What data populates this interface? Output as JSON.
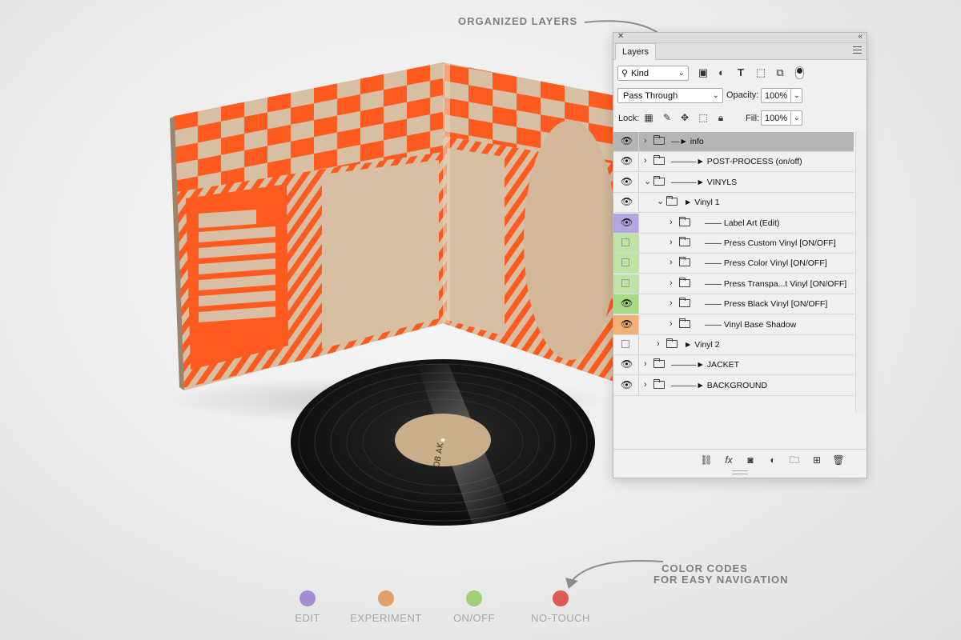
{
  "annotations": {
    "organized_layers": "ORGANIZED LAYERS",
    "color_codes_line1": "COLOR CODES",
    "color_codes_line2": "FOR EASY NAVIGATION"
  },
  "legend": [
    {
      "label": "EDIT",
      "color": "#a78bd6"
    },
    {
      "label": "EXPERIMENT",
      "color": "#e0a06a"
    },
    {
      "label": "ON/OFF",
      "color": "#9fd172"
    },
    {
      "label": "NO-TOUCH",
      "color": "#e05a54"
    }
  ],
  "vinyl_label_text": "OB AK",
  "panel": {
    "tab_label": "Layers",
    "filter": {
      "value": "Kind"
    },
    "blend_mode": "Pass Through",
    "opacity_label": "Opacity:",
    "opacity_value": "100%",
    "lock_label": "Lock:",
    "fill_label": "Fill:",
    "fill_value": "100%",
    "layers": [
      {
        "name": "—► info",
        "visible": true,
        "selected": true
      },
      {
        "name": "———► POST-PROCESS (on/off)",
        "visible": true
      },
      {
        "name": "———► VINYLS",
        "visible": true,
        "expanded": true
      },
      {
        "name": "► Vinyl 1",
        "visible": true,
        "expanded": true
      },
      {
        "name": "—— Label Art (Edit)",
        "visible": true,
        "color": "#b4a6e0"
      },
      {
        "name": "—— Press Custom Vinyl [ON/OFF]",
        "visible": false,
        "color": "#bfe3a4"
      },
      {
        "name": "—— Press Color Vinyl [ON/OFF]",
        "visible": false,
        "color": "#bfe3a4"
      },
      {
        "name": "—— Press Transpa...t Vinyl [ON/OFF]",
        "visible": false,
        "color": "#bfe3a4"
      },
      {
        "name": "—— Press Black Vinyl [ON/OFF]",
        "visible": true,
        "color": "#a8da86"
      },
      {
        "name": "—— Vinyl Base Shadow",
        "visible": true,
        "color": "#f2b079"
      },
      {
        "name": "► Vinyl 2",
        "visible": false
      },
      {
        "name": "———► JACKET",
        "visible": true
      },
      {
        "name": "———► BACKGROUND",
        "visible": true
      }
    ]
  }
}
